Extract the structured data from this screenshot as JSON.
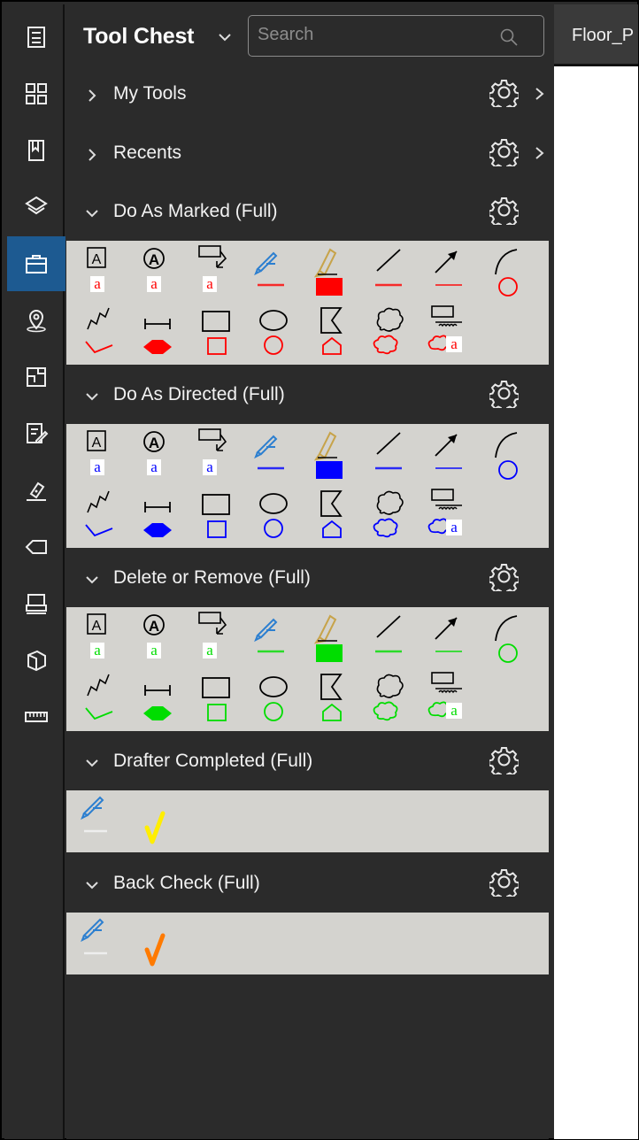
{
  "panel": {
    "title": "Tool Chest",
    "search_placeholder": "Search"
  },
  "sections": [
    {
      "label": "My Tools",
      "expanded": false
    },
    {
      "label": "Recents",
      "expanded": false
    },
    {
      "label": "Do As Marked (Full)",
      "expanded": true,
      "color": "#ff0000"
    },
    {
      "label": "Do As Directed (Full)",
      "expanded": true,
      "color": "#0000ff"
    },
    {
      "label": "Delete or Remove (Full)",
      "expanded": true,
      "color": "#00dd00"
    },
    {
      "label": "Drafter Completed (Full)",
      "expanded": true,
      "color": "#ffee00"
    },
    {
      "label": "Back Check (Full)",
      "expanded": true,
      "color": "#ff7a00"
    }
  ],
  "tool_glyphs": {
    "text_box_letter": "A",
    "sample_letter": "a"
  },
  "document_tab": {
    "label": "Floor_P"
  },
  "icons": [
    "document-icon",
    "thumbnails-icon",
    "bookmarks-icon",
    "layers-icon",
    "toolbox-icon",
    "location-icon",
    "spaces-icon",
    "markups-list-icon",
    "signature-icon",
    "tag-icon",
    "scanner-icon",
    "3d-shape-icon",
    "ruler-icon"
  ]
}
